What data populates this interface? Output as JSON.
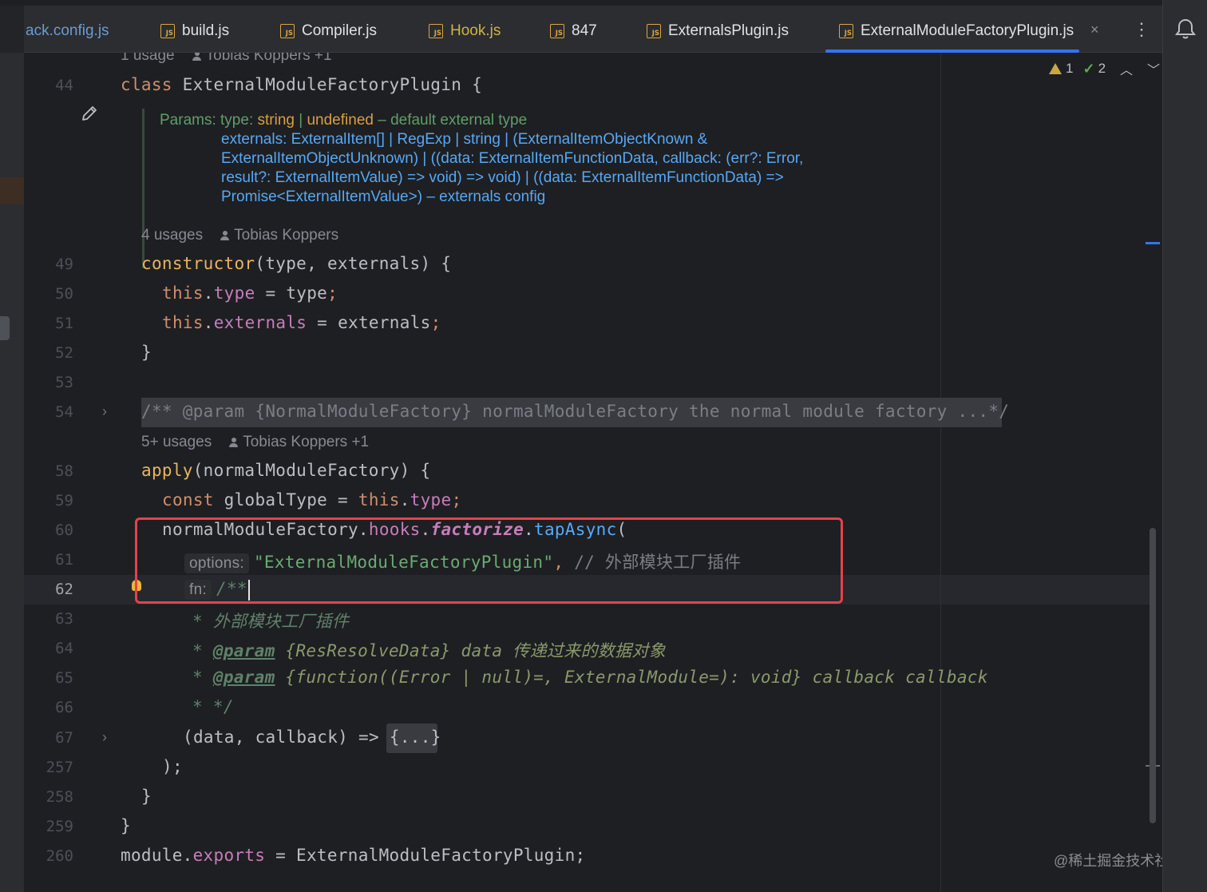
{
  "tabs": [
    {
      "label": "ack.config.js",
      "icon": false,
      "state": "dim"
    },
    {
      "label": "build.js",
      "icon": true,
      "state": "normal"
    },
    {
      "label": "Compiler.js",
      "icon": true,
      "state": "normal"
    },
    {
      "label": "Hook.js",
      "icon": true,
      "state": "modified"
    },
    {
      "label": "847",
      "icon": true,
      "state": "normal"
    },
    {
      "label": "ExternalsPlugin.js",
      "icon": true,
      "state": "normal"
    },
    {
      "label": "ExternalModuleFactoryPlugin.js",
      "icon": true,
      "state": "active"
    }
  ],
  "tab_icon_text": "JS",
  "tab_close": "×",
  "inspections": {
    "warnings": "1",
    "ok": "2"
  },
  "usages": {
    "top": {
      "count": "1 usage",
      "author": "Tobias Koppers +1"
    },
    "ctor": {
      "count": "4 usages",
      "author": "Tobias Koppers"
    },
    "apply": {
      "count": "5+ usages",
      "author": "Tobias Koppers +1"
    }
  },
  "doc": {
    "line1": {
      "label": "Params:",
      "name": "type:",
      "t1": "string",
      "sep": "|",
      "t2": "undefined",
      "desc": "– default external type"
    },
    "line2": "externals: ExternalItem[] | RegExp | string | (ExternalItemObjectKnown &",
    "line3": "ExternalItemObjectUnknown) | ((data: ExternalItemFunctionData, callback: (err?: Error,",
    "line4": "result?: ExternalItemValue) => void) => void) | ((data: ExternalItemFunctionData) =>",
    "line5": "Promise<ExternalItemValue>) – externals config"
  },
  "lines": {
    "44": "44",
    "49": "49",
    "50": "50",
    "51": "51",
    "52": "52",
    "53": "53",
    "54": "54",
    "58": "58",
    "59": "59",
    "60": "60",
    "61": "61",
    "62": "62",
    "63": "63",
    "64": "64",
    "65": "65",
    "66": "66",
    "67": "67",
    "257": "257",
    "258": "258",
    "259": "259",
    "260": "260"
  },
  "code": {
    "class_kw": "class",
    "class_name": "ExternalModuleFactoryPlugin {",
    "ctor_name": "constructor",
    "ctor_args": "(type, externals) {",
    "this": "this",
    "type_prop": "type",
    "assign_type": " = type",
    "externals_prop": "externals",
    "assign_externals": " = externals",
    "semicolon": ";",
    "close_brace": "}",
    "folded_comment": "/** @param {NormalModuleFactory} normalModuleFactory the normal module factory ...*/",
    "apply_name": "apply",
    "apply_args": "(normalModuleFactory) {",
    "const_kw": "const",
    "global_type": " globalType = ",
    "type_end": "type",
    "nmf": "normalModuleFactory.",
    "hooks": "hooks",
    "factorize": "factorize",
    "tap_async": "tapAsync",
    "open_paren": "(",
    "dot": ".",
    "options_hint": "options:",
    "options_str": "\"ExternalModuleFactoryPlugin\"",
    "comma": ",",
    "options_comment": "// 外部模块工厂插件",
    "fn_hint": "fn:",
    "doc_open": "/**",
    "doc63": "* 外部模块工厂插件",
    "doc64_star": "* ",
    "doc64_tag": "@param",
    "doc64_type": "{ResResolveData}",
    "doc64_rest": " data 传递过来的数据对象",
    "doc65_star": "* ",
    "doc65_tag": "@param",
    "doc65_type": "{function((Error | null)=, ExternalModule=): void}",
    "doc65_rest": " callback callback",
    "doc66": "* */",
    "arrow_fn": "(data, callback) => ",
    "folded_body": "{...}",
    "close_call": ");",
    "module": "module.",
    "exports": "exports",
    "exports_rest": " = ExternalModuleFactoryPlugin;"
  },
  "watermark": "@稀土掘金技术社区",
  "colors": {
    "accent": "#3574f0",
    "highlight_box": "#e3434b",
    "keyword": "#cf8e6d",
    "string": "#6aab73"
  }
}
